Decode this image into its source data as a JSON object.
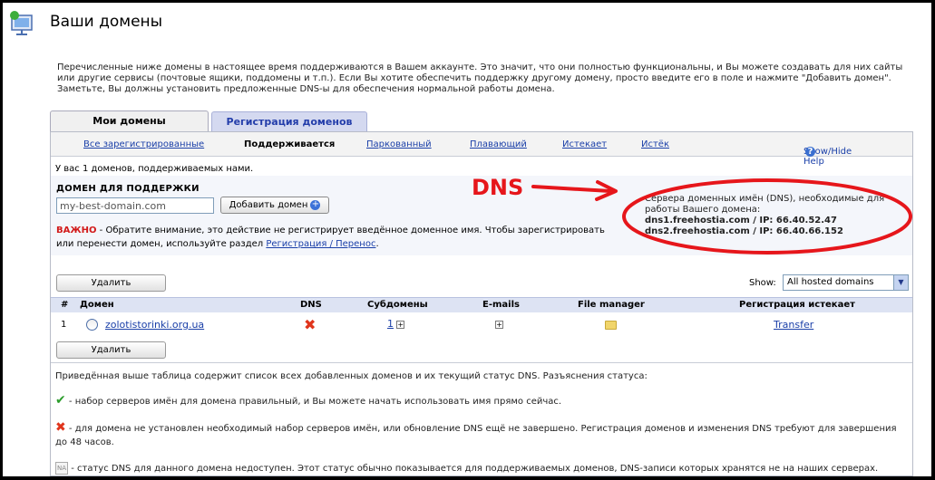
{
  "page": {
    "title": "Ваши домены",
    "intro": "Перечисленные ниже домены в настоящее время поддерживаются в Вашем аккаунте. Это значит, что они полностью функциональны, и Вы можете создавать для них сайты или другие сервисы (почтовые ящики, поддомены и т.п.). Если Вы хотите обеспечить поддержку другому домену, просто введите его в поле и нажмите \"Добавить домен\". Заметьте, Вы должны установить предложенные DNS-ы для обеспечения нормальной работы домена."
  },
  "tabs": [
    {
      "label": "Мои домены"
    },
    {
      "label": "Регистрация доменов"
    }
  ],
  "subnav": {
    "items": [
      "Все зарегистрированные",
      "Поддерживается",
      "Паркованный",
      "Плавающий",
      "Истекает",
      "Истёк"
    ],
    "help": "Show/Hide Help",
    "help_icon": "?"
  },
  "count_line": "У вас 1 доменов, поддерживаемых нами.",
  "add_domain": {
    "label": "ДОМЕН ДЛЯ ПОДДЕРЖКИ",
    "input_value": "my-best-domain.com",
    "button": "Добавить домен",
    "warning_strong": "ВАЖНО",
    "warning_text": " - Обратите внимание, это действие не регистрирует введённое доменное имя. Чтобы зарегистрировать",
    "warning_text2": "или перенести домен, используйте раздел ",
    "warning_link": "Регистрация / Перенос",
    "warning_end": "."
  },
  "dns_info": {
    "text": "Сервера доменных имён (DNS), необходимые для работы Вашего домена:",
    "servers": [
      "dns1.freehostia.com / IP: 66.40.52.47",
      "dns2.freehostia.com / IP: 66.40.66.152"
    ]
  },
  "annotation": {
    "label": "DNS",
    "color": "#e6161b"
  },
  "toolbar": {
    "delete_label": "Удалить",
    "show_label": "Show:",
    "show_value": "All hosted domains"
  },
  "table": {
    "headers": [
      "#",
      "Домен",
      "DNS",
      "Субдомены",
      "E-mails",
      "File manager",
      "Регистрация истекает"
    ],
    "rows": [
      {
        "num": "1",
        "domain": "zolotistorinki.org.ua",
        "subdomains": "1",
        "expires": "Transfer"
      }
    ]
  },
  "legend": {
    "intro": "Приведённая выше таблица содержит список всех добавленных доменов и их текущий статус DNS. Разъяснения статуса:",
    "ok": " - набор серверов имён для домена правильный, и Вы можете начать использовать имя прямо сейчас.",
    "bad": " - для домена не установлен необходимый набор серверов имён, или обновление DNS ещё не завершено. Регистрация доменов и изменения DNS требуют для завершения до 48 часов.",
    "na_icon": "NA",
    "na": " - статус DNS для данного домена недоступен. Этот статус обычно показывается для поддерживаемых доменов, DNS-записи которых хранятся не на наших серверах."
  }
}
